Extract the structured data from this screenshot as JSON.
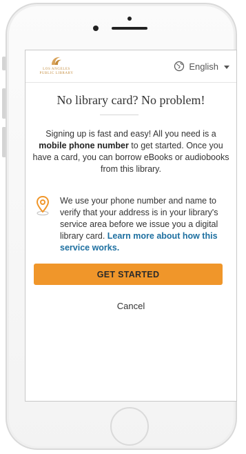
{
  "header": {
    "logo_line1": "LOS ANGELES",
    "logo_line2": "PUBLIC LIBRARY",
    "language": "English"
  },
  "main": {
    "title": "No library card? No problem!",
    "intro_part1": "Signing up is fast and easy! All you need is a ",
    "intro_bold": "mobile phone number",
    "intro_part2": " to get started. Once you have a card, you can borrow eBooks or audiobooks from this library.",
    "notice_text": "We use your phone number and name to verify that your address is in your library's service area before we issue you a digital library card. ",
    "notice_link": "Learn more about how this service works.",
    "cta_label": "GET STARTED",
    "cancel_label": "Cancel"
  },
  "colors": {
    "accent": "#f0962a",
    "link": "#1d6fa0",
    "brand": "#c28a3a"
  },
  "icons": {
    "globe": "globe-icon",
    "pin": "location-pin-icon",
    "logo": "library-logo-icon",
    "caret": "chevron-down-icon"
  }
}
